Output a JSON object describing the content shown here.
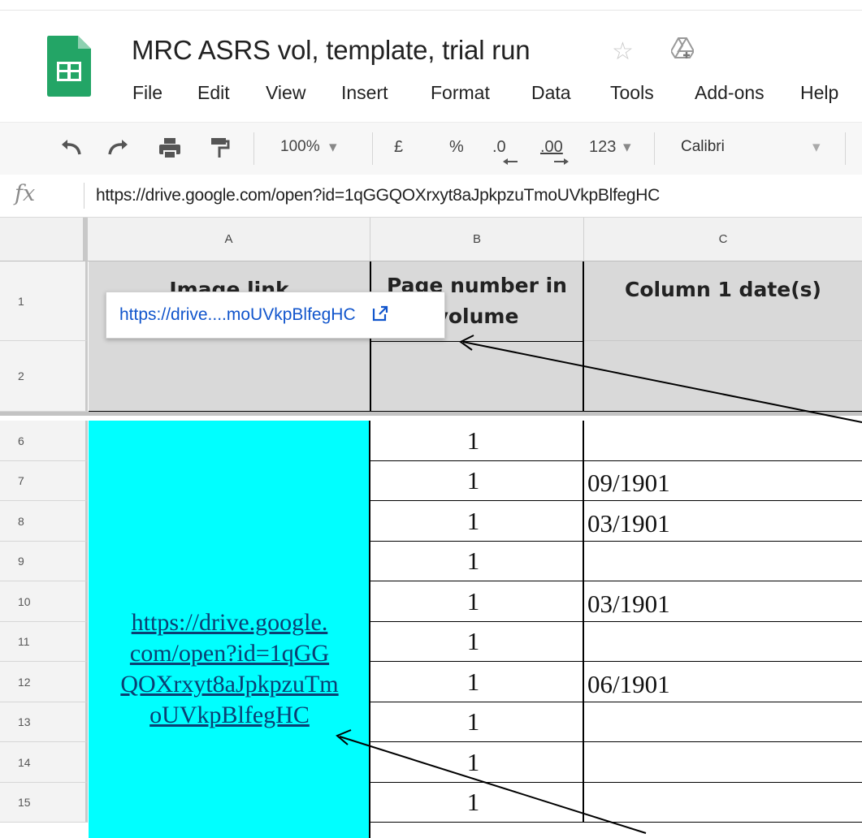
{
  "document": {
    "title": "MRC ASRS vol, template, trial run",
    "icons": [
      "sheets-logo-icon",
      "star-icon",
      "drive-icon"
    ]
  },
  "menu": [
    "File",
    "Edit",
    "View",
    "Insert",
    "Format",
    "Data",
    "Tools",
    "Add-ons",
    "Help"
  ],
  "toolbar": {
    "zoom": "100%",
    "currency": "£",
    "percent": "%",
    "decrease_decimal": ".0",
    "increase_decimal": ".00",
    "more_formats": "123",
    "font": "Calibri"
  },
  "formula_bar": {
    "label": "fx",
    "value": "https://drive.google.com/open?id=1qGGQOXrxyt8aJpkpzuTmoUVkpBlfegHC"
  },
  "columns": [
    "A",
    "B",
    "C"
  ],
  "header_rows": [
    "1",
    "2"
  ],
  "headers": {
    "a": "Image link",
    "b": "Page number in volume",
    "c": "Column 1 date(s)"
  },
  "rows": [
    {
      "num": "6",
      "b": "1",
      "c": ""
    },
    {
      "num": "7",
      "b": "1",
      "c": "09/1901"
    },
    {
      "num": "8",
      "b": "1",
      "c": "03/1901"
    },
    {
      "num": "9",
      "b": "1",
      "c": ""
    },
    {
      "num": "10",
      "b": "1",
      "c": "03/1901"
    },
    {
      "num": "11",
      "b": "1",
      "c": ""
    },
    {
      "num": "12",
      "b": "1",
      "c": "06/1901"
    },
    {
      "num": "13",
      "b": "1",
      "c": ""
    },
    {
      "num": "14",
      "b": "1",
      "c": ""
    },
    {
      "num": "15",
      "b": "1",
      "c": ""
    }
  ],
  "merged_a": {
    "lines": [
      "https://drive.google.",
      "com/open?id=1qGG",
      "QOXrxyt8aJpkpzuTm",
      "oUVkpBlfegHC"
    ],
    "fill_color": "#00ffff"
  },
  "tooltip": {
    "text": "https://drive....moUVkpBlfegHC"
  }
}
